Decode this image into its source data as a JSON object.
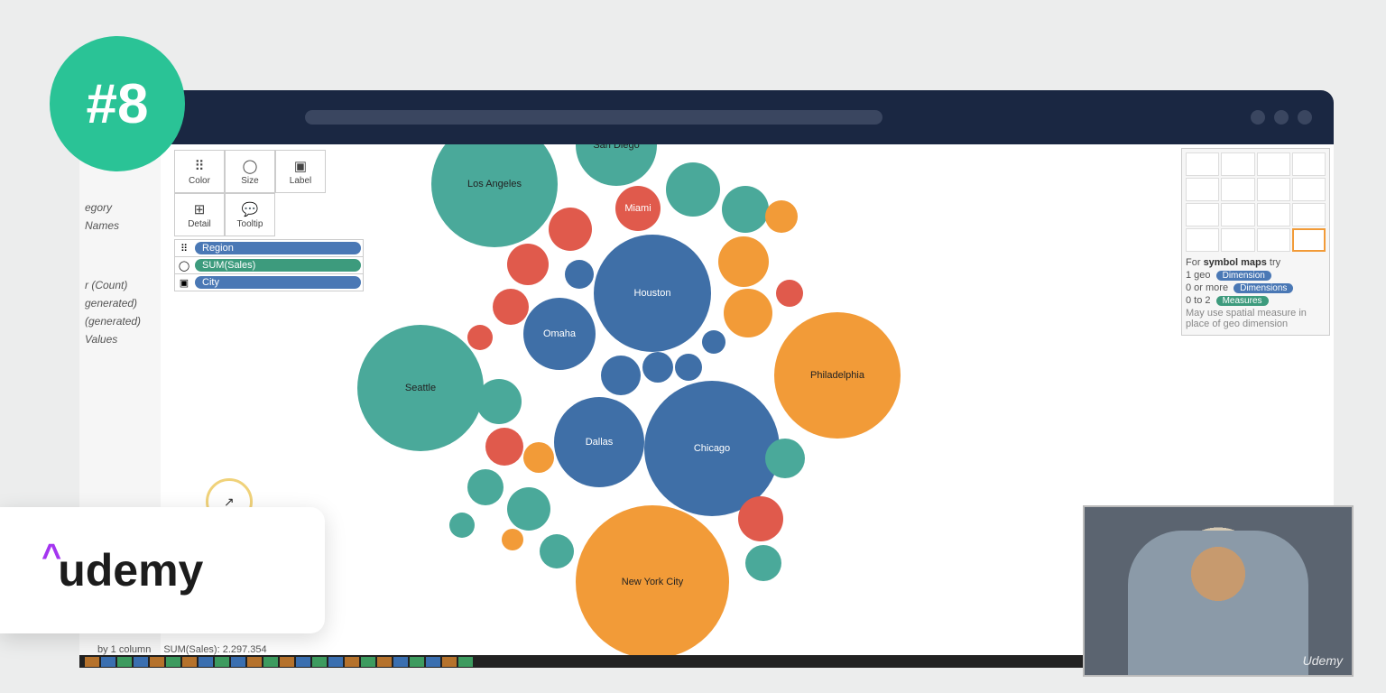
{
  "badge": "#8",
  "brand": "udemy",
  "marks": {
    "color": "Color",
    "size": "Size",
    "label": "Label",
    "detail": "Detail",
    "tooltip": "Tooltip"
  },
  "encodings": {
    "region": "Region",
    "sales": "SUM(Sales)",
    "city": "City"
  },
  "sidepane": [
    "egory",
    "Names",
    "r (Count)",
    "generated)",
    " (generated)",
    "Values"
  ],
  "bubbles": {
    "la": "Los Angeles",
    "sd": "San Diego",
    "mia": "Miami",
    "hou": "Houston",
    "oma": "Omaha",
    "sea": "Seattle",
    "phi": "Philadelphia",
    "dal": "Dallas",
    "chi": "Chicago",
    "nyc": "New York City"
  },
  "showme": {
    "title_pre": "For ",
    "title_b": "symbol maps",
    "title_post": " try",
    "r1": "1 geo",
    "r1_pill": "Dimension",
    "r2": "0 or more",
    "r2_pill": "Dimensions",
    "r3": "0 to 2",
    "r3_pill": "Measures",
    "note": "May use spatial measure in place of geo dimension"
  },
  "status": {
    "left": "by 1 column",
    "right": "SUM(Sales): 2.297.354"
  },
  "watermark": "Udemy"
}
